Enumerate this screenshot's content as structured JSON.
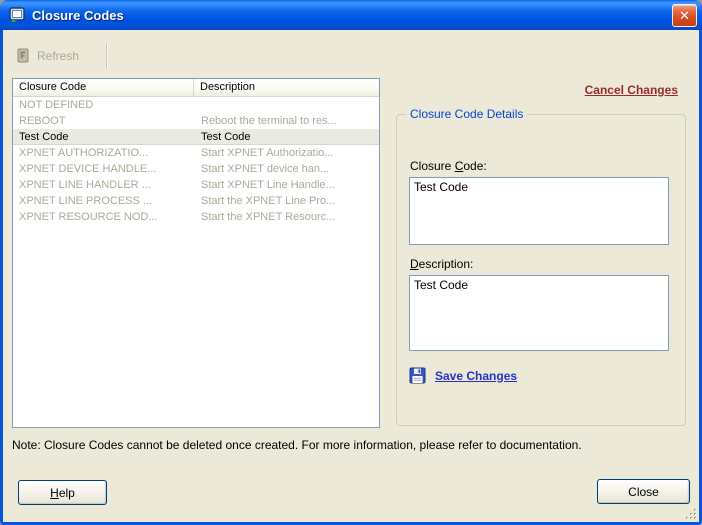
{
  "window": {
    "title": "Closure Codes",
    "close_glyph": "✕"
  },
  "toolbar": {
    "refresh_label": "Refresh",
    "refresh_enabled": false
  },
  "list": {
    "columns": [
      {
        "label": "Closure Code"
      },
      {
        "label": "Description"
      }
    ],
    "rows": [
      {
        "code": "NOT DEFINED",
        "description": "",
        "state": "disabled"
      },
      {
        "code": "REBOOT",
        "description": "Reboot the terminal to res...",
        "state": "disabled"
      },
      {
        "code": "Test Code",
        "description": "Test Code",
        "state": "selected"
      },
      {
        "code": "XPNET AUTHORIZATIO...",
        "description": "Start XPNET Authorizatio...",
        "state": "disabled"
      },
      {
        "code": "XPNET DEVICE HANDLE...",
        "description": "Start XPNET device han...",
        "state": "disabled"
      },
      {
        "code": "XPNET LINE HANDLER ...",
        "description": "Start XPNET Line Handle...",
        "state": "disabled"
      },
      {
        "code": "XPNET LINE PROCESS ...",
        "description": "Start the XPNET Line Pro...",
        "state": "disabled"
      },
      {
        "code": "XPNET RESOURCE NOD...",
        "description": "Start the XPNET Resourc...",
        "state": "disabled"
      }
    ]
  },
  "details": {
    "cancel_link": "Cancel Changes",
    "group_title": "Closure Code Details",
    "code_label": {
      "text": "Closure Code:",
      "mnemonic_index": 8
    },
    "code_value": "Test Code",
    "description_label": {
      "text": "Description:",
      "mnemonic_index": 0
    },
    "description_value": "Test Code",
    "save_link": "Save Changes"
  },
  "note": "Note: Closure Codes cannot be deleted once created. For more information, please refer to documentation.",
  "footer": {
    "help": {
      "text": "Help",
      "mnemonic_index": 0
    },
    "close_label": "Close"
  },
  "colors": {
    "titlebar_blue": "#0054E3",
    "window_border_blue": "#0855DD",
    "window_bg": "#ECE9D8",
    "disabled_text": "#ACA899",
    "selected_row_bg": "#EBEAE1",
    "field_border": "#7F9DB9",
    "group_title_blue": "#0046D5",
    "cancel_link_red": "#9B2B2B",
    "save_link_blue": "#2233CC",
    "close_button_red": "#D9501F"
  }
}
